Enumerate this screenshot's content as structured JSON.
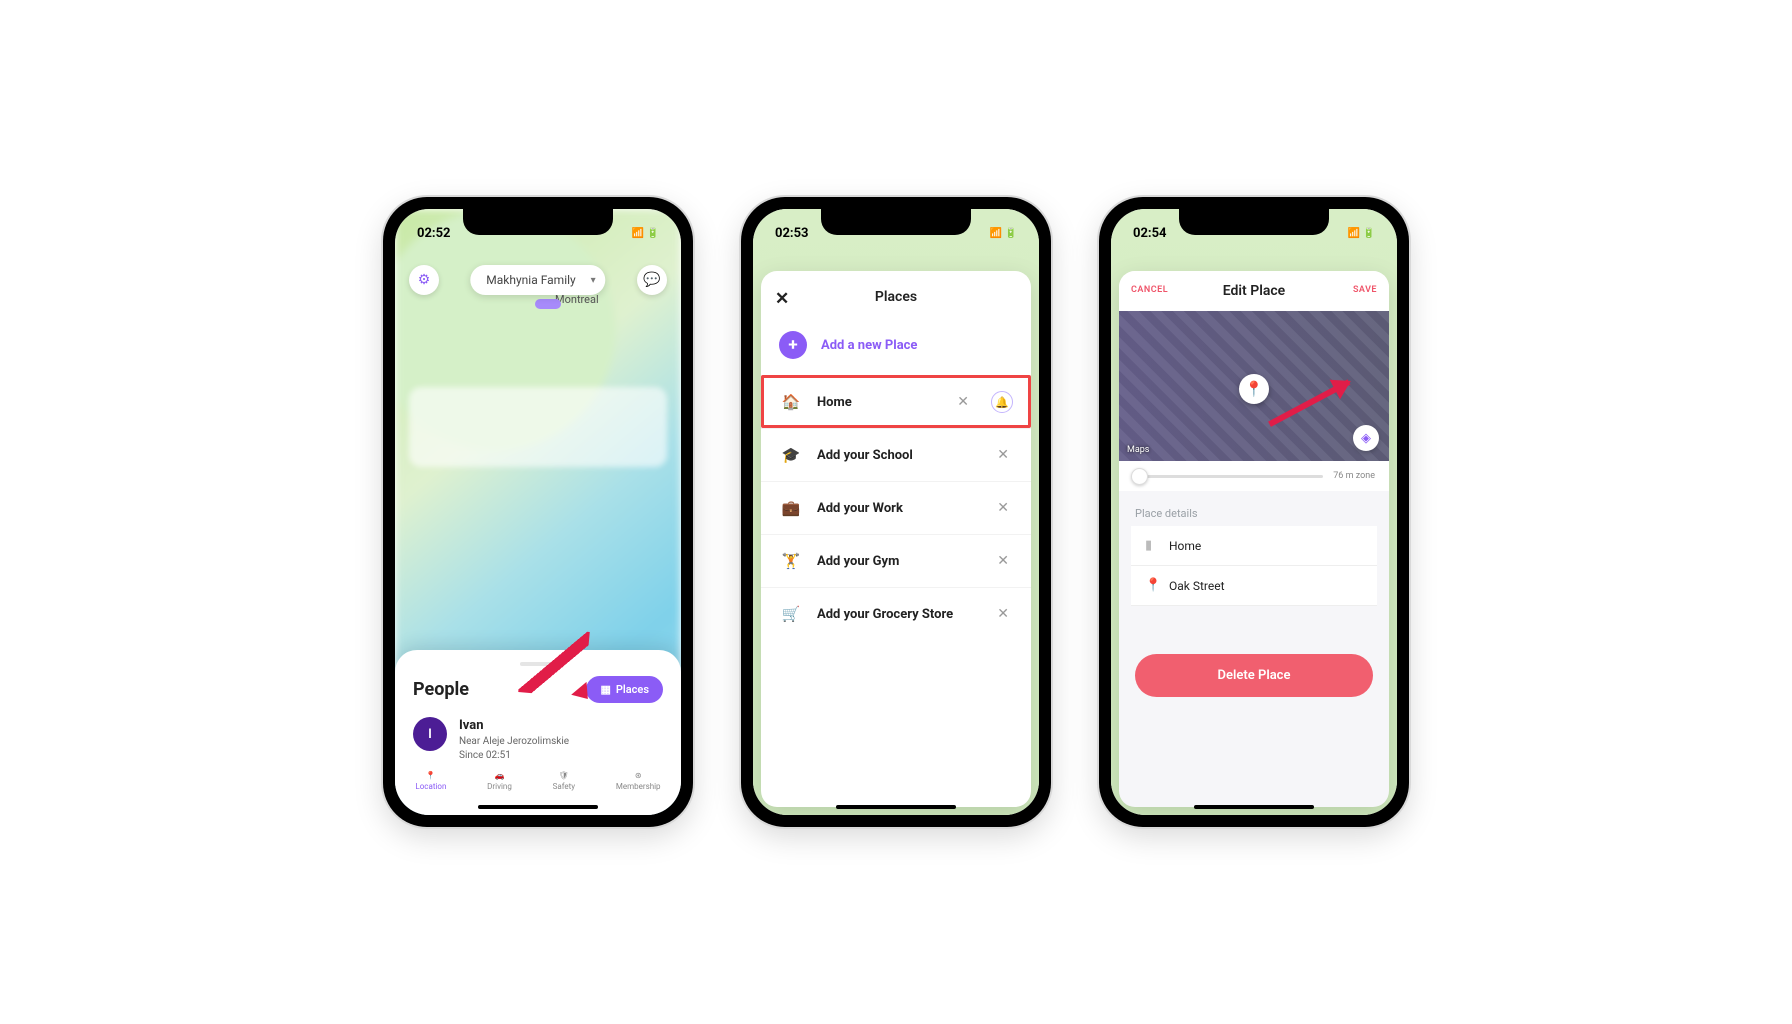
{
  "phone1": {
    "time": "02:52",
    "familyName": "Makhynia Family",
    "cityLabel": "Montreal",
    "sheet": {
      "title": "People",
      "placesBtn": "Places",
      "person": {
        "initial": "I",
        "name": "Ivan",
        "line1": "Near Aleje Jerozolimskie",
        "line2": "Since 02:51"
      }
    },
    "tabs": {
      "location": "Location",
      "driving": "Driving",
      "safety": "Safety",
      "membership": "Membership"
    }
  },
  "phone2": {
    "time": "02:53",
    "title": "Places",
    "addLabel": "Add a new Place",
    "items": {
      "home": "Home",
      "school": "Add your School",
      "work": "Add your Work",
      "gym": "Add your Gym",
      "grocery": "Add your Grocery Store"
    }
  },
  "phone3": {
    "time": "02:54",
    "cancel": "CANCEL",
    "title": "Edit Place",
    "save": "SAVE",
    "mapAttr": "Maps",
    "zone": "76 m zone",
    "section": "Place details",
    "name": "Home",
    "address": "Oak Street",
    "delete": "Delete Place"
  }
}
